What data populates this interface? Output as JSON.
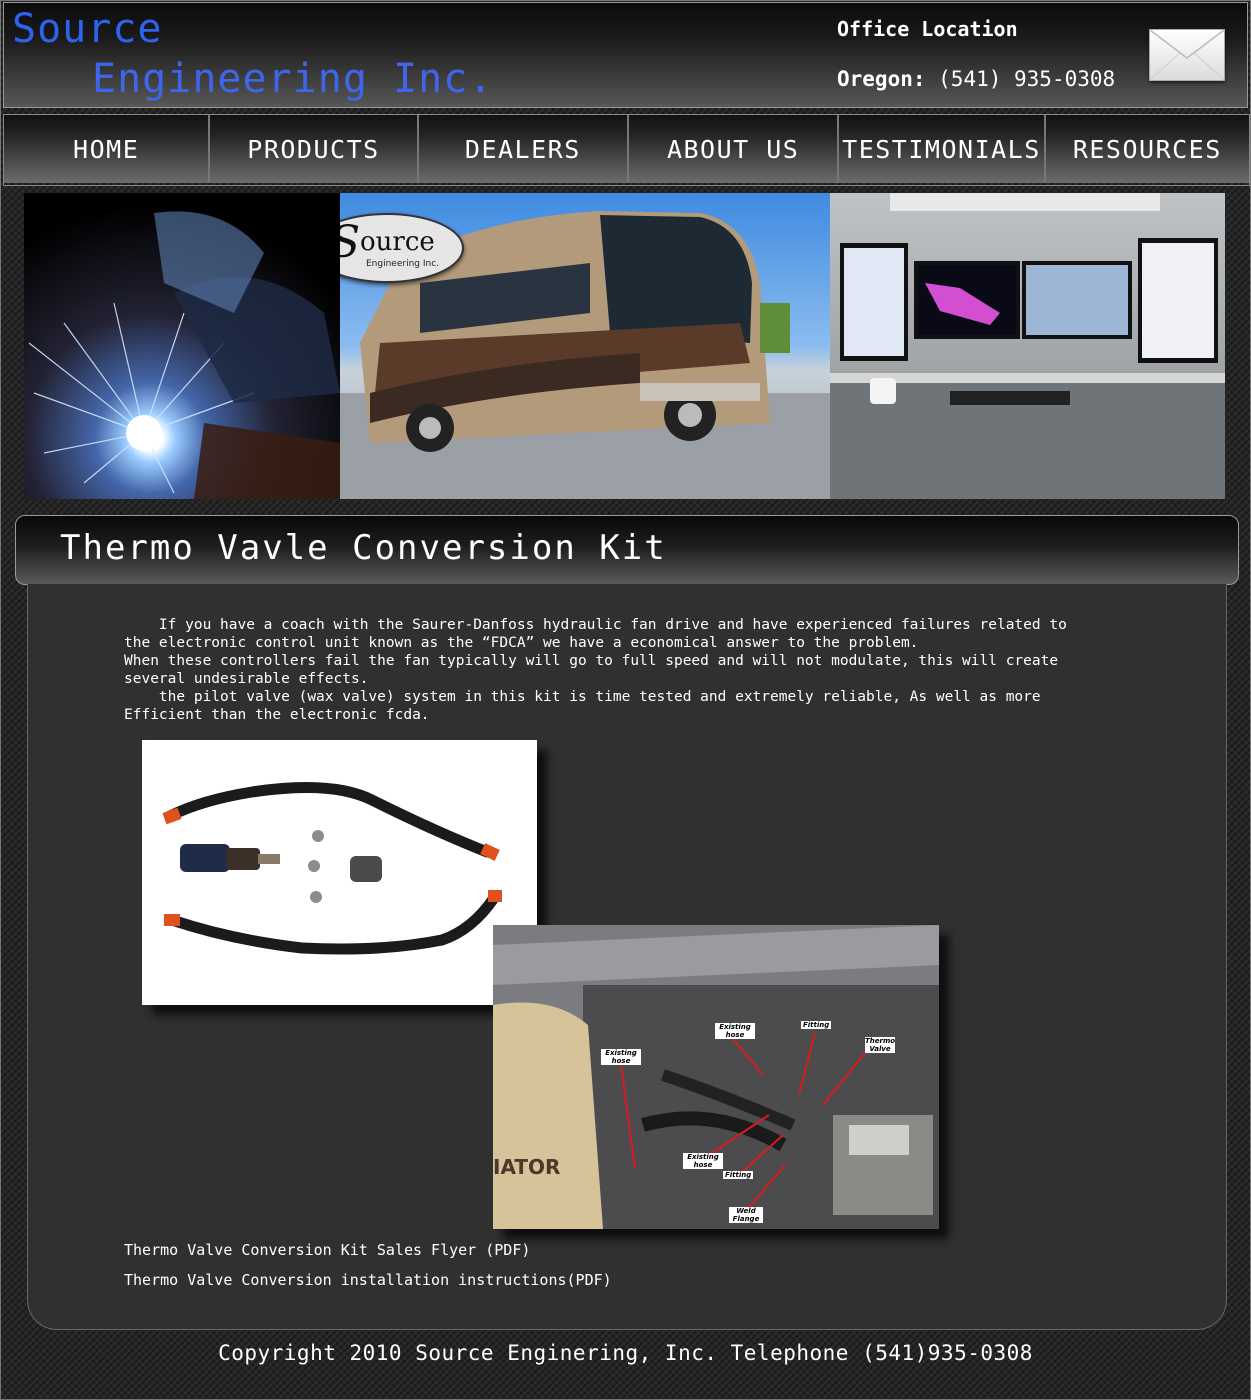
{
  "header": {
    "logo_line1": "Source",
    "logo_line2": "Engineering Inc.",
    "office_label": "Office Location",
    "office_state": "Oregon:",
    "office_phone": " (541) 935-0308",
    "mail_icon": "envelope-icon"
  },
  "nav": {
    "items": [
      "HOME",
      "PRODUCTS",
      "DEALERS",
      "ABOUT US",
      "TESTIMONIALS",
      "RESOURCES"
    ]
  },
  "banner": {
    "logo_text": "ource",
    "logo_sub": "Engineering Inc."
  },
  "page": {
    "title": "Thermo Vavle Conversion Kit",
    "intro": "    If you have a coach with the Saurer-Danfoss hydraulic fan drive and have experienced failures related to\nthe electronic control unit known as the “FDCA” we have a economical answer to the problem.\nWhen these controllers fail the fan typically will go to full speed and will not modulate, this will create\nseveral undesirable effects.\n    the pilot valve (wax valve) system in this kit is time tested and extremely reliable, As well as more\nEfficient than the electronic fcda."
  },
  "install_photo": {
    "labels": {
      "existing_hose_1": "Existing hose",
      "fitting_1": "Fitting",
      "thermo_valve": "Thermo Valve",
      "existing_hose_2": "Existing hose",
      "existing_hose_3": "Existing hose",
      "fitting_2": "Fitting",
      "weld_flange": "Weld Flange",
      "radiator": "IATOR"
    }
  },
  "links": {
    "flyer": "Thermo Valve Conversion Kit Sales Flyer (PDF)",
    "instructions": "Thermo Valve Conversion installation instructions(PDF)"
  },
  "footer": {
    "text": "Copyright 2010 Source Enginering, Inc. Telephone (541)935-0308"
  },
  "colors": {
    "logo_blue": "#2e63ee",
    "panel_bg": "#303030"
  }
}
